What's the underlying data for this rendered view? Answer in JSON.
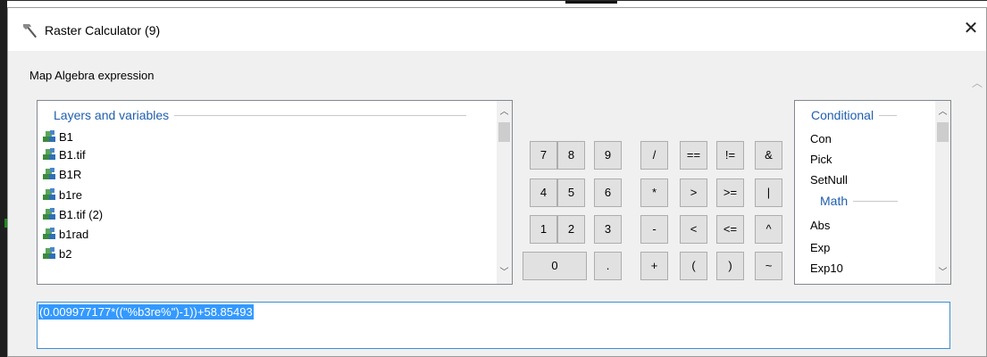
{
  "window": {
    "title": "Raster Calculator (9)",
    "close_glyph": "✕"
  },
  "expression_label": "Map Algebra expression",
  "layers_panel": {
    "header": "Layers and variables",
    "items": [
      {
        "label": "B1",
        "icon": "raster-layer-icon"
      },
      {
        "label": "B1.tif",
        "icon": "raster-layer-icon"
      },
      {
        "label": "B1R",
        "icon": "raster-layer-icon"
      },
      {
        "label": "b1re",
        "icon": "raster-layer-icon"
      },
      {
        "label": "B1.tif (2)",
        "icon": "raster-layer-icon"
      },
      {
        "label": "b1rad",
        "icon": "raster-layer-icon"
      },
      {
        "label": "b2",
        "icon": "raster-layer-icon"
      }
    ]
  },
  "calculator": {
    "buttons": [
      "7",
      "8",
      "9",
      "/",
      "==",
      "!=",
      "&",
      "4",
      "5",
      "6",
      "*",
      ">",
      ">=",
      "|",
      "1",
      "2",
      "3",
      "-",
      "<",
      "<=",
      "^",
      "0",
      ".",
      "+",
      "(",
      ")",
      "~"
    ]
  },
  "functions_panel": {
    "sections": [
      {
        "header": "Conditional",
        "items": [
          "Con",
          "Pick",
          "SetNull"
        ]
      },
      {
        "header": "Math",
        "items": [
          "Abs",
          "Exp",
          "Exp10"
        ]
      }
    ]
  },
  "expression": {
    "value": "(0.009977177*((\"%b3re%\")-1))+58.85493"
  },
  "colors": {
    "section_header": "#1f5fae",
    "selection": "#3399ff",
    "focus_border": "#3f8fd2"
  }
}
